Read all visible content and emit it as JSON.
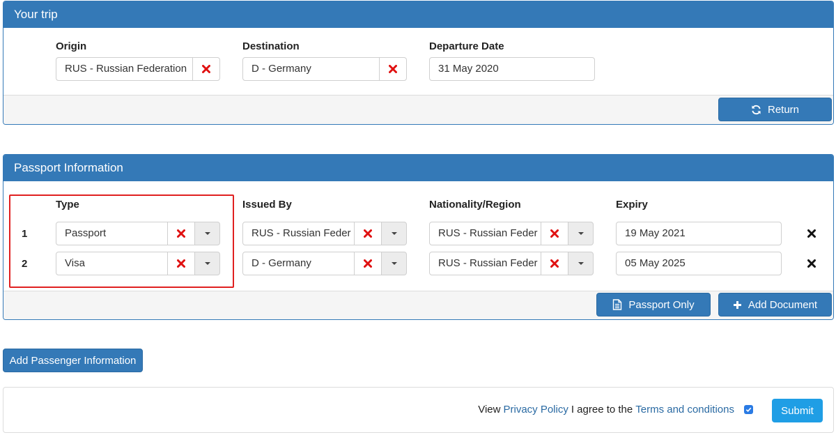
{
  "trip": {
    "title": "Your trip",
    "origin_label": "Origin",
    "origin_value": "RUS - Russian Federation",
    "destination_label": "Destination",
    "destination_value": "D - Germany",
    "departure_label": "Departure Date",
    "departure_value": "31 May 2020",
    "return_label": "Return"
  },
  "passport": {
    "title": "Passport Information",
    "headers": {
      "type": "Type",
      "issued_by": "Issued By",
      "nationality": "Nationality/Region",
      "expiry": "Expiry"
    },
    "rows": [
      {
        "num": "1",
        "type": "Passport",
        "issued_by": "RUS - Russian Feder",
        "nationality": "RUS - Russian Feder",
        "expiry": "19 May 2021"
      },
      {
        "num": "2",
        "type": "Visa",
        "issued_by": "D - Germany",
        "nationality": "RUS - Russian Feder",
        "expiry": "05 May 2025"
      }
    ],
    "passport_only_label": "Passport Only",
    "add_document_label": "Add Document"
  },
  "add_passenger_label": "Add Passenger Information",
  "footer": {
    "view_text": "View",
    "privacy_link": "Privacy Policy",
    "agree_text": "I agree to the",
    "terms_link": "Terms and conditions",
    "terms_checked": true,
    "submit_label": "Submit"
  },
  "colors": {
    "primary": "#3479b7",
    "submit": "#1f9ee5",
    "remove_x": "#e01010",
    "highlight": "#e02020"
  },
  "icons": {
    "clear": "red-x-icon",
    "dropdown": "caret-down-icon",
    "delete_row": "black-x-icon",
    "return": "refresh-icon",
    "passport_only": "document-icon",
    "add_document": "plus-icon",
    "checkbox": "checkmark-icon"
  }
}
